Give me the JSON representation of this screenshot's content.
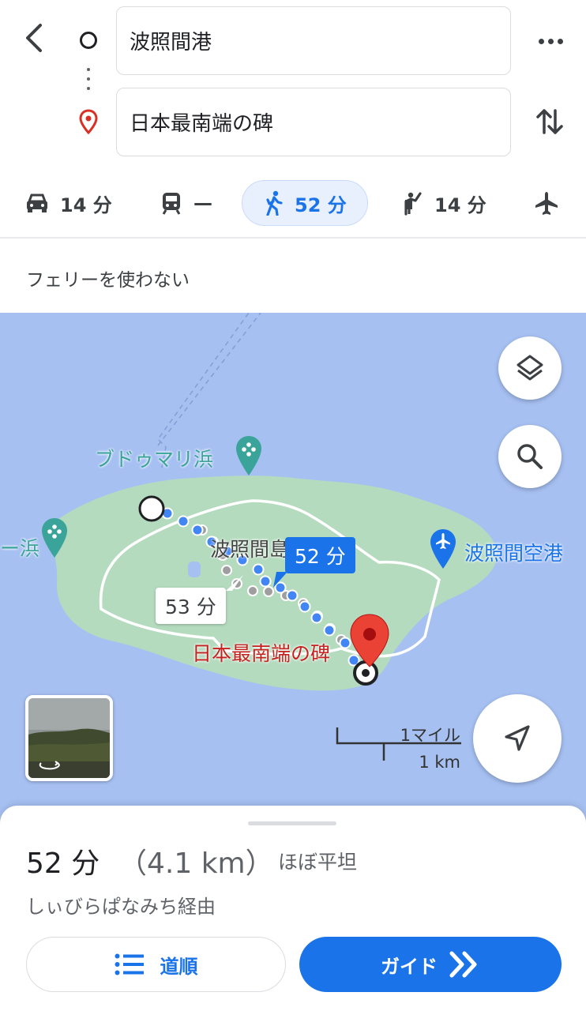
{
  "header": {
    "origin_value": "波照間港",
    "destination_value": "日本最南端の碑"
  },
  "modes": [
    {
      "name": "drive",
      "label": "14 分",
      "icon": "car-icon"
    },
    {
      "name": "transit",
      "label": "—",
      "icon": "train-icon"
    },
    {
      "name": "walk",
      "label": "52 分",
      "icon": "walk-icon",
      "active": true
    },
    {
      "name": "ride",
      "label": "14 分",
      "icon": "ride-hail-icon"
    },
    {
      "name": "flight",
      "label": "",
      "icon": "airplane-icon"
    }
  ],
  "options": {
    "label": "フェリーを使わない"
  },
  "map": {
    "labels": {
      "budoumari": "ブドゥマリ浜",
      "beach_left": "ー浜",
      "island": "波照間島",
      "airport": "波照間空港",
      "destination": "日本最南端の碑"
    },
    "route_callout_primary": "52 分",
    "route_callout_alt": "53 分",
    "scale_mile": "1マイル",
    "scale_km": "1 km"
  },
  "sheet": {
    "duration": "52 分",
    "distance": "（4.1 km）",
    "terrain": "ほぼ平坦",
    "via": "しぃびらぱなみち経由",
    "steps_label": "道順",
    "guide_label": "ガイド"
  },
  "colors": {
    "accent": "#1a73e8",
    "water": "#a6c0f2",
    "land": "#b5dbbf",
    "pin": "#ea4335"
  }
}
